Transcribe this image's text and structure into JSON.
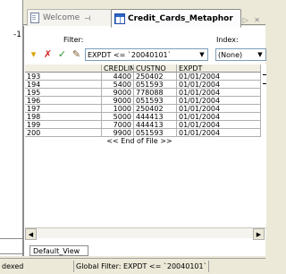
{
  "tabs": {
    "welcome_label": "Welcome",
    "active_label": "Credit_Cards_Metaphor",
    "nav_glyphs": "◁ ▷ ✕"
  },
  "toolbar": {
    "filter_label": "Filter:",
    "index_label": "Index:",
    "filter_value": "EXPDT <= `20040101`",
    "index_value": "(None)",
    "icons": [
      "filter-funnel-icon",
      "clear-filter-icon",
      "apply-filter-icon",
      "filter-builder-icon"
    ]
  },
  "grid": {
    "columns": [
      "",
      "CREDLIM",
      "CUSTNO",
      "EXPDT"
    ],
    "rows": [
      {
        "num": "193",
        "credlim": "4400",
        "custno": "250402",
        "expdt": "01/01/2004"
      },
      {
        "num": "194",
        "credlim": "5400",
        "custno": "051593",
        "expdt": "01/01/2004"
      },
      {
        "num": "195",
        "credlim": "9000",
        "custno": "778088",
        "expdt": "01/01/2004"
      },
      {
        "num": "196",
        "credlim": "9000",
        "custno": "051593",
        "expdt": "01/01/2004"
      },
      {
        "num": "197",
        "credlim": "1000",
        "custno": "250402",
        "expdt": "01/01/2004"
      },
      {
        "num": "198",
        "credlim": "5000",
        "custno": "444413",
        "expdt": "01/01/2004"
      },
      {
        "num": "199",
        "credlim": "7000",
        "custno": "444413",
        "expdt": "01/01/2004"
      },
      {
        "num": "200",
        "credlim": "9900",
        "custno": "051593",
        "expdt": "01/01/2004"
      }
    ],
    "eof_text": "<< End of File >>"
  },
  "view_tab": {
    "label": "Default_View"
  },
  "status": {
    "left_text": "dexed",
    "filter_text": "Global Filter: EXPDT <= `20040101`"
  },
  "colors": {
    "background": "#ece9d8",
    "grid_header": "#f1efe2",
    "combo_border": "#7f9db9"
  }
}
